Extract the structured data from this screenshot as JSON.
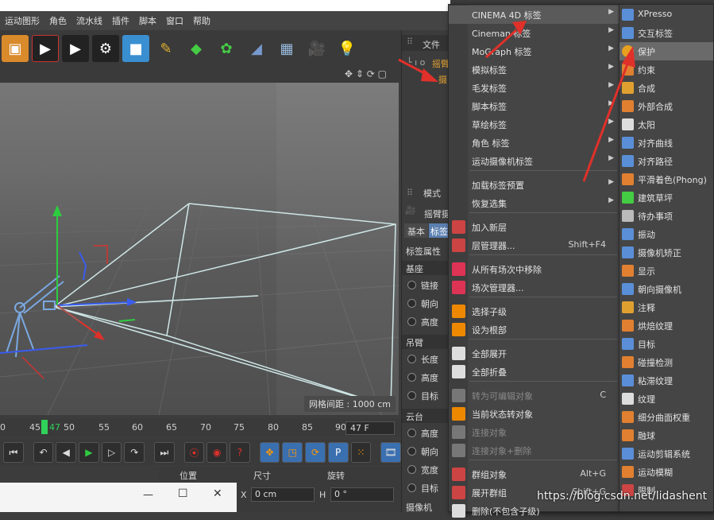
{
  "menubar": [
    "运动图形",
    "角色",
    "流水线",
    "插件",
    "脚本",
    "窗口",
    "帮助"
  ],
  "object_panel": {
    "label": "文件",
    "item1": "摇臂",
    "item2": "摄"
  },
  "attr_panel": {
    "mode": "模式",
    "object": "摇臂摄",
    "tab_basic": "基本",
    "tab_tag": "标签",
    "tag_props": "标签属性",
    "sec_base": "基座",
    "link": "链接",
    "heading": "朝向",
    "height": "高度",
    "sec_arm": "吊臂",
    "length": "长度",
    "height2": "高度",
    "target": "目标",
    "sec_cloud": "云台",
    "height3": "高度",
    "heading2": "朝向",
    "width": "宽度",
    "target2": "目标",
    "camera": "摄像机"
  },
  "viewport": {
    "grid_note": "网格间距 : 1000 cm"
  },
  "timeline": {
    "ticks": [
      "0",
      "45",
      "47",
      "50",
      "55",
      "60",
      "65",
      "70",
      "75",
      "80",
      "85",
      "90"
    ],
    "current_frame": "47 F"
  },
  "coords": {
    "pos": "位置",
    "size": "尺寸",
    "rot": "旋转",
    "x": "X",
    "x_val": "0 cm",
    "h": "H",
    "h_val": "0 °"
  },
  "window_ctrl": {
    "min": "—",
    "max": "☐",
    "close": "✕"
  },
  "menu1": {
    "items": [
      {
        "label": "CINEMA 4D 标签",
        "arrow": "▶"
      },
      {
        "label": "Cineman 标签",
        "arrow": "▶"
      },
      {
        "label": "MoGraph 标签",
        "arrow": "▶"
      },
      {
        "label": "模拟标签",
        "arrow": "▶"
      },
      {
        "label": "毛发标签",
        "arrow": "▶"
      },
      {
        "label": "脚本标签",
        "arrow": "▶"
      },
      {
        "label": "草绘标签",
        "arrow": "▶"
      },
      {
        "label": "角色 标签",
        "arrow": "▶"
      },
      {
        "label": "运动摄像机标签",
        "arrow": "▶"
      },
      {
        "label": "加载标签预置",
        "arrow": "▶"
      },
      {
        "label": "恢复选集",
        "arrow": "▶"
      },
      {
        "label": "加入新层",
        "shortcut": ""
      },
      {
        "label": "层管理器...",
        "shortcut": "Shift+F4"
      },
      {
        "label": "从所有场次中移除",
        "shortcut": ""
      },
      {
        "label": "场次管理器...",
        "shortcut": ""
      },
      {
        "label": "选择子级",
        "shortcut": ""
      },
      {
        "label": "设为根部",
        "shortcut": ""
      },
      {
        "label": "全部展开",
        "shortcut": ""
      },
      {
        "label": "全部折叠",
        "shortcut": ""
      },
      {
        "label": "转为可编辑对象",
        "shortcut": "C"
      },
      {
        "label": "当前状态转对象",
        "shortcut": ""
      },
      {
        "label": "连接对象",
        "shortcut": ""
      },
      {
        "label": "连接对象+删除",
        "shortcut": ""
      },
      {
        "label": "群组对象",
        "shortcut": "Alt+G"
      },
      {
        "label": "展开群组",
        "shortcut": "Shift+G"
      },
      {
        "label": "删除(不包含子级)",
        "shortcut": ""
      }
    ]
  },
  "menu2": {
    "items": [
      "XPresso",
      "交互标签",
      "保护",
      "约束",
      "合成",
      "外部合成",
      "太阳",
      "对齐曲线",
      "对齐路径",
      "平滑着色(Phong)",
      "建筑草坪",
      "待办事项",
      "振动",
      "摄像机矫正",
      "显示",
      "朝向摄像机",
      "注释",
      "烘焙纹理",
      "目标",
      "碰撞检测",
      "粘滞纹理",
      "纹理",
      "细分曲面权重",
      "融球",
      "运动剪辑系统",
      "运动模糊",
      "限制"
    ]
  },
  "watermark": "https://blog.csdn.net/lidashent",
  "colors": {
    "accent_red": "#e0302a",
    "menu_bg": "#454545",
    "highlight": "#5a5a5a"
  }
}
